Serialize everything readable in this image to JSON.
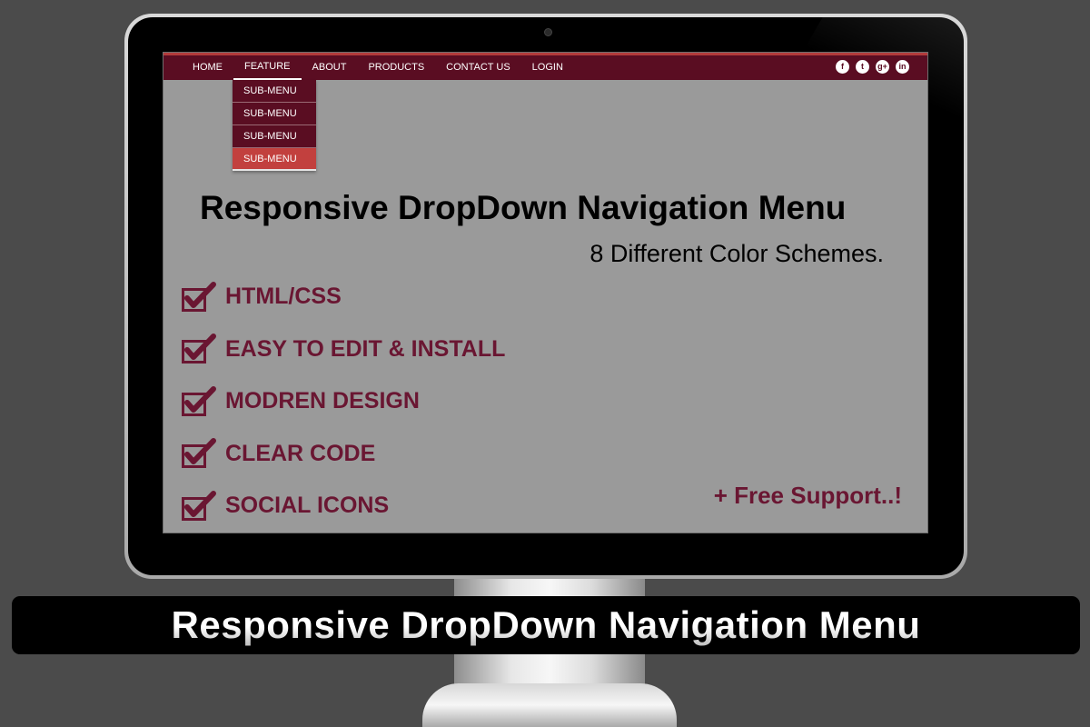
{
  "navbar": {
    "items": [
      "HOME",
      "FEATURE",
      "ABOUT",
      "PRODUCTS",
      "CONTACT US",
      "LOGIN"
    ],
    "active_item": "FEATURE",
    "social_icons": [
      {
        "name": "facebook-icon",
        "glyph": "f"
      },
      {
        "name": "twitter-icon",
        "glyph": "t"
      },
      {
        "name": "google-plus-icon",
        "glyph": "g+"
      },
      {
        "name": "linkedin-icon",
        "glyph": "in"
      }
    ]
  },
  "dropdown": {
    "items": [
      "SUB-MENU",
      "SUB-MENU",
      "SUB-MENU",
      "SUB-MENU"
    ]
  },
  "hero": {
    "headline": "Responsive DropDown Navigation Menu",
    "subline": "8 Different Color Schemes."
  },
  "features": [
    "HTML/CSS",
    "EASY TO EDIT & INSTALL",
    "MODREN DESIGN",
    "CLEAR CODE",
    "SOCIAL ICONS"
  ],
  "support": "+ Free Support..!",
  "banner": {
    "title": "Responsive DropDown Navigation Menu"
  },
  "colors": {
    "nav_bg": "#5a0d22",
    "accent_red": "#c2403e",
    "feature_text": "#6a1632",
    "screen_bg": "#9a9a9a"
  }
}
